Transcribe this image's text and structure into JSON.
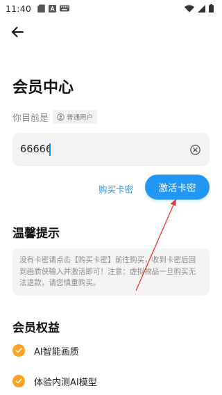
{
  "status_bar": {
    "time": "11:40"
  },
  "header": {
    "back_icon": "arrow-left-icon"
  },
  "page": {
    "title": "会员中心",
    "current_label": "你目前是",
    "user_badge": "普通用户"
  },
  "key_input": {
    "value": "66666"
  },
  "actions": {
    "buy_link": "购买卡密",
    "activate_button": "激活卡密"
  },
  "tips": {
    "title": "温馨提示",
    "text": "没有卡密请点击【购买卡密】前往购买，收到卡密后回到画质侠输入并激活即可！注意：虚拟物品一旦购买无法退款，请您慎重购买。"
  },
  "benefits": {
    "title": "会员权益",
    "items": [
      {
        "label": "AI智能画质"
      },
      {
        "label": "体验内测AI模型"
      }
    ]
  },
  "colors": {
    "accent": "#2196f3",
    "check": "#ffa21f",
    "annotation_arrow": "#e53935"
  }
}
